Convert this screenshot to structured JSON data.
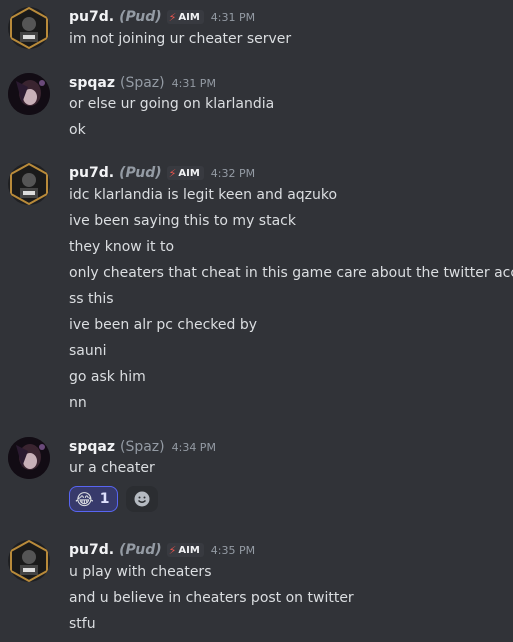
{
  "messages": [
    {
      "author": "pu7d.",
      "nick": "(Pud)",
      "tag": "AIM",
      "time": "4:31 PM",
      "lines": [
        "im not joining ur cheater server"
      ]
    },
    {
      "author": "spqaz",
      "nick": "(Spaz)",
      "time": "4:31 PM",
      "lines": [
        "or else ur going on klarlandia",
        "ok"
      ]
    },
    {
      "author": "pu7d.",
      "nick": "(Pud)",
      "tag": "AIM",
      "time": "4:32 PM",
      "lines": [
        "idc klarlandia is legit keen and aqzuko",
        "ive been saying this to my stack",
        "they know it to",
        "only cheaters that cheat in this game care about the twitter acc",
        "ss this",
        "ive been alr pc checked by",
        "sauni",
        "go ask him",
        "nn"
      ]
    },
    {
      "author": "spqaz",
      "nick": "(Spaz)",
      "time": "4:34 PM",
      "lines": [
        "ur a cheater"
      ],
      "reaction": {
        "emoji": "😂",
        "count": "1"
      }
    },
    {
      "author": "pu7d.",
      "nick": "(Pud)",
      "tag": "AIM",
      "time": "4:35 PM",
      "lines": [
        "u play with cheaters",
        "and u believe in cheaters post on twitter",
        "stfu"
      ]
    }
  ],
  "icons": {
    "tag_icon": "lightning-bolt-icon",
    "add_reaction": "smiley-add-icon"
  },
  "colors": {
    "background": "#313338",
    "reaction_border": "#5865f2",
    "tag_bolt": "#e4534d"
  }
}
